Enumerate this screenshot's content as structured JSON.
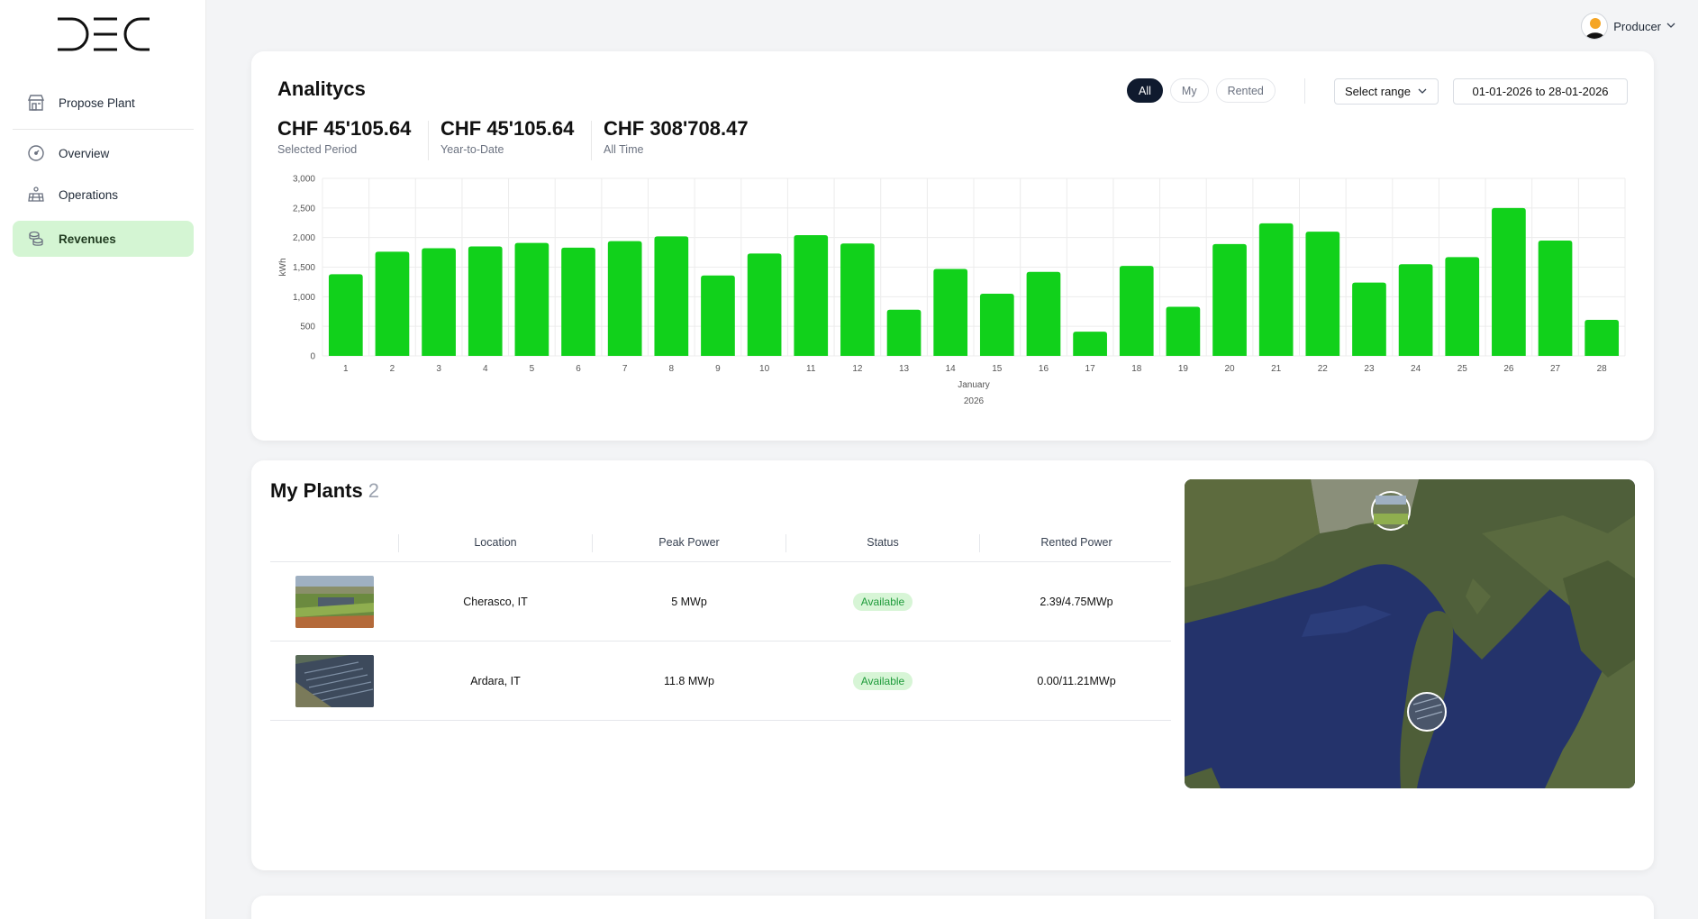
{
  "sidebar": {
    "logo": "DEC",
    "items": [
      {
        "label": "Propose Plant",
        "icon": "store-icon"
      },
      {
        "label": "Overview",
        "icon": "gauge-icon"
      },
      {
        "label": "Operations",
        "icon": "solar-panel-icon"
      },
      {
        "label": "Revenues",
        "icon": "coins-icon",
        "active": true
      }
    ]
  },
  "header": {
    "user_name": "Producer"
  },
  "analytics": {
    "title": "Analitycs",
    "filters": [
      "All",
      "My",
      "Rented"
    ],
    "active_filter": "All",
    "range_select": "Select range",
    "date_range": "01-01-2026 to 28-01-2026",
    "kpis": [
      {
        "value": "CHF 45'105.64",
        "label": "Selected Period"
      },
      {
        "value": "CHF 45'105.64",
        "label": "Year-to-Date"
      },
      {
        "value": "CHF 308'708.47",
        "label": "All Time"
      }
    ]
  },
  "chart_data": {
    "type": "bar",
    "categories": [
      "1",
      "2",
      "3",
      "4",
      "5",
      "6",
      "7",
      "8",
      "9",
      "10",
      "11",
      "12",
      "13",
      "14",
      "15",
      "16",
      "17",
      "18",
      "19",
      "20",
      "21",
      "22",
      "23",
      "24",
      "25",
      "26",
      "27",
      "28"
    ],
    "values": [
      1380,
      1760,
      1820,
      1850,
      1910,
      1830,
      1940,
      2020,
      1360,
      1730,
      2040,
      1900,
      780,
      1470,
      1050,
      1420,
      410,
      1520,
      830,
      1890,
      2240,
      2100,
      1240,
      1550,
      1670,
      2500,
      1950,
      610
    ],
    "ylabel": "kWh",
    "xlabel": "January",
    "xlabel2": "2026",
    "ylim": [
      0,
      3000
    ],
    "yticks": [
      "0",
      "500",
      "1,000",
      "1,500",
      "2,000",
      "2,500",
      "3,000"
    ],
    "bar_color": "#11d11b",
    "grid": true
  },
  "plants": {
    "title": "My Plants",
    "count": "2",
    "columns": [
      "Location",
      "Peak Power",
      "Status",
      "Rented Power"
    ],
    "rows": [
      {
        "location": "Cherasco, IT",
        "peak_power": "5 MWp",
        "status": "Available",
        "rented_power": "2.39/4.75MWp"
      },
      {
        "location": "Ardara, IT",
        "peak_power": "11.8 MWp",
        "status": "Available",
        "rented_power": "0.00/11.21MWp"
      }
    ]
  }
}
